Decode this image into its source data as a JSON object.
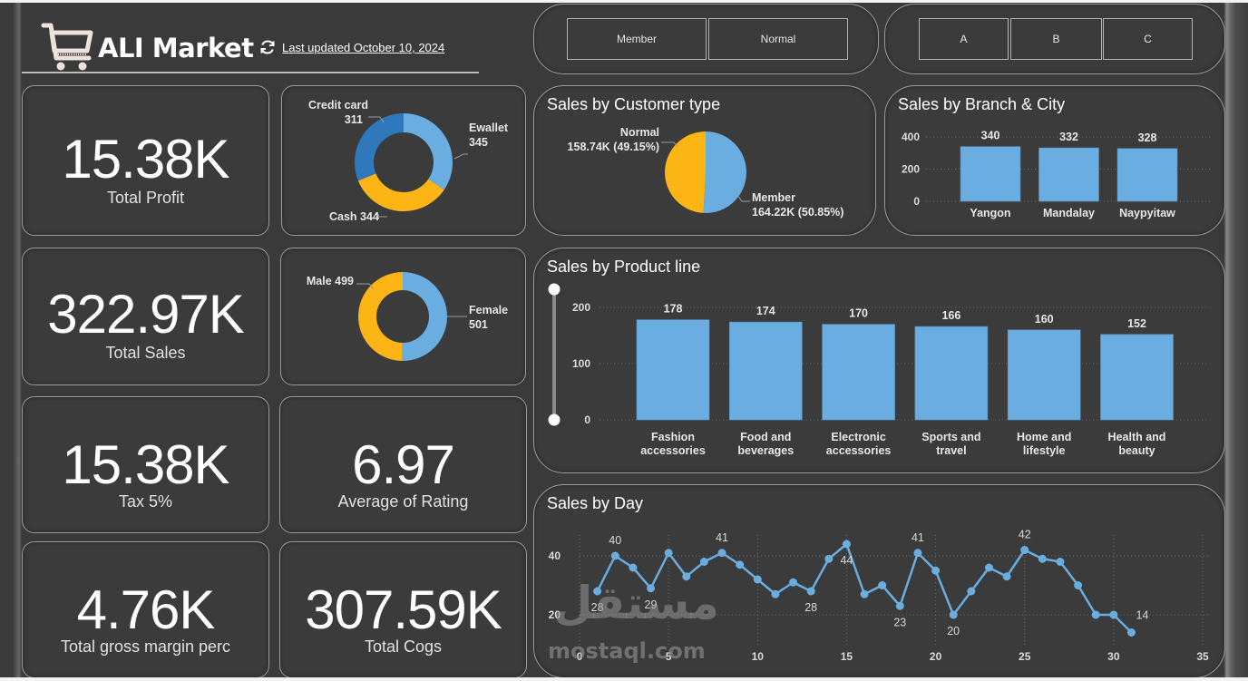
{
  "header": {
    "title": "ALI Market",
    "last_updated": "Last updated October 10, 2024",
    "logo_icon": "shopping-cart-icon",
    "refresh_icon": "refresh-icon"
  },
  "slicers": {
    "customer_type": [
      "Member",
      "Normal"
    ],
    "branch": [
      "A",
      "B",
      "C"
    ]
  },
  "kpis": [
    {
      "id": "total-profit",
      "value": "15.38K",
      "label": "Total Profit"
    },
    {
      "id": "total-sales",
      "value": "322.97K",
      "label": "Total Sales"
    },
    {
      "id": "tax",
      "value": "15.38K",
      "label": "Tax 5%"
    },
    {
      "id": "average-rating",
      "value": "6.97",
      "label": "Average of Rating"
    },
    {
      "id": "gross-margin",
      "value": "4.76K",
      "label": "Total gross margin perc"
    },
    {
      "id": "total-cogs",
      "value": "307.59K",
      "label": "Total Cogs"
    }
  ],
  "colors": {
    "light_blue": "#6aade0",
    "dark_blue": "#2f78bc",
    "yellow": "#fdb515",
    "background": "#3a3a3a",
    "card_border": "#9a9a9a"
  },
  "watermark": {
    "arabic": "مستقل",
    "latin": "mostaql.com"
  },
  "chart_data": [
    {
      "id": "payment",
      "type": "pie",
      "donut": true,
      "title": "",
      "slices": [
        {
          "label": "Ewallet",
          "value": 345,
          "color": "#6aade0"
        },
        {
          "label": "Cash",
          "value": 344,
          "color": "#fdb515"
        },
        {
          "label": "Credit card",
          "value": 311,
          "color": "#2f78bc"
        }
      ]
    },
    {
      "id": "gender",
      "type": "pie",
      "donut": true,
      "title": "",
      "slices": [
        {
          "label": "Female",
          "value": 501,
          "color": "#6aade0"
        },
        {
          "label": "Male",
          "value": 499,
          "color": "#fdb515"
        }
      ]
    },
    {
      "id": "customer_type",
      "type": "pie",
      "donut": false,
      "title": "Sales by Customer type",
      "slices": [
        {
          "label": "Member",
          "value": 164.22,
          "display": "164.22K (50.85%)",
          "color": "#6aade0"
        },
        {
          "label": "Normal",
          "value": 158.74,
          "display": "158.74K (49.15%)",
          "color": "#fdb515"
        }
      ]
    },
    {
      "id": "branch_city",
      "type": "bar",
      "title": "Sales by Branch & City",
      "categories": [
        "Yangon",
        "Mandalay",
        "Naypyitaw"
      ],
      "values": [
        340,
        332,
        328
      ],
      "yticks": [
        0,
        200,
        400
      ],
      "ylim": [
        0,
        400
      ],
      "grid": true,
      "xlabel": "",
      "ylabel": ""
    },
    {
      "id": "product_line",
      "type": "bar",
      "title": "Sales by Product line",
      "categories": [
        "Fashion accessories",
        "Food and beverages",
        "Electronic accessories",
        "Sports and travel",
        "Home and lifestyle",
        "Health and beauty"
      ],
      "category_lines": [
        [
          "Fashion",
          "accessories"
        ],
        [
          "Food and",
          "beverages"
        ],
        [
          "Electronic",
          "accessories"
        ],
        [
          "Sports and",
          "travel"
        ],
        [
          "Home and",
          "lifestyle"
        ],
        [
          "Health and",
          "beauty"
        ]
      ],
      "values": [
        178,
        174,
        170,
        166,
        160,
        152
      ],
      "yticks": [
        0,
        100,
        200
      ],
      "ylim": [
        0,
        200
      ],
      "grid": true,
      "xlabel": "",
      "ylabel": ""
    },
    {
      "id": "sales_by_day",
      "type": "line",
      "title": "Sales by Day",
      "x": [
        1,
        2,
        3,
        4,
        5,
        6,
        7,
        8,
        9,
        10,
        11,
        12,
        13,
        14,
        15,
        16,
        17,
        18,
        19,
        20,
        21,
        22,
        23,
        24,
        25,
        26,
        27,
        28,
        29,
        30,
        31
      ],
      "values": [
        28,
        40,
        36,
        29,
        41,
        33,
        38,
        41,
        37,
        32,
        27,
        31,
        28,
        39,
        44,
        27,
        30,
        23,
        41,
        35,
        20,
        28,
        36,
        33,
        42,
        39,
        38,
        30,
        20,
        20,
        14
      ],
      "labeled_points": {
        "1": "28",
        "2": "40",
        "4": "29",
        "8": "41",
        "13": "28",
        "15": "44",
        "18": "23",
        "19": "41",
        "21": "20",
        "25": "42",
        "31": "14"
      },
      "xticks": [
        0,
        5,
        10,
        15,
        20,
        25,
        30,
        35
      ],
      "yticks": [
        20,
        40
      ],
      "xlim": [
        0,
        35
      ],
      "ylim": [
        12,
        48
      ],
      "grid": true,
      "color": "#6aade0",
      "xlabel": "",
      "ylabel": ""
    }
  ]
}
